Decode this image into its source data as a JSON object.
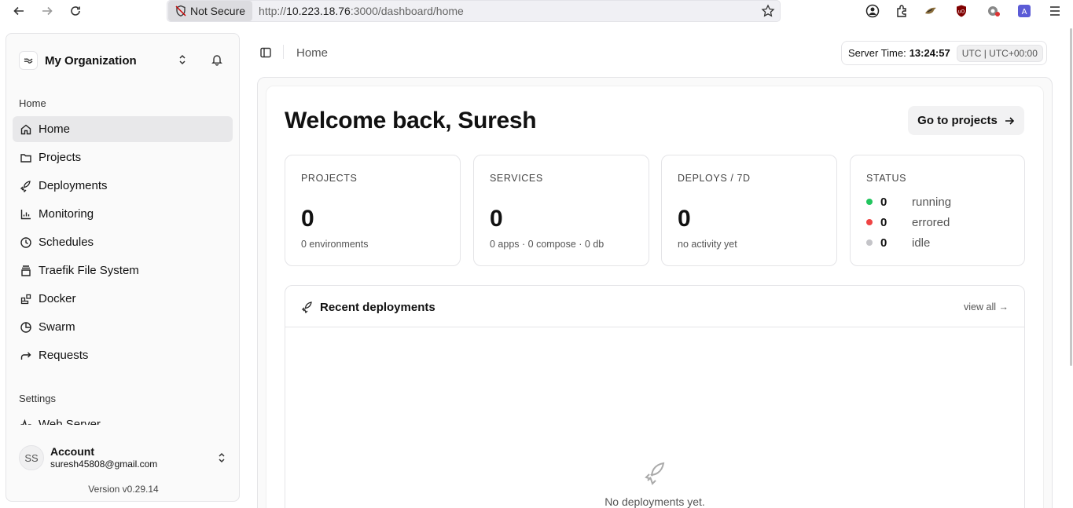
{
  "browser": {
    "not_secure": "Not Secure",
    "url_prefix": "http://",
    "url_host": "10.223.18.76",
    "url_rest": ":3000/dashboard/home"
  },
  "sidebar": {
    "org_name": "My Organization",
    "section_home": "Home",
    "section_settings": "Settings",
    "items": [
      {
        "label": "Home",
        "icon": "home-icon"
      },
      {
        "label": "Projects",
        "icon": "folder-icon"
      },
      {
        "label": "Deployments",
        "icon": "rocket-icon"
      },
      {
        "label": "Monitoring",
        "icon": "chart-icon"
      },
      {
        "label": "Schedules",
        "icon": "clock-icon"
      },
      {
        "label": "Traefik File System",
        "icon": "file-stack-icon"
      },
      {
        "label": "Docker",
        "icon": "blocks-icon"
      },
      {
        "label": "Swarm",
        "icon": "pie-icon"
      },
      {
        "label": "Requests",
        "icon": "forward-icon"
      }
    ],
    "settings_items": [
      {
        "label": "Web Server",
        "icon": "activity-icon"
      }
    ],
    "account": {
      "initials": "SS",
      "name": "Account",
      "email": "suresh45808@gmail.com"
    },
    "version": "Version v0.29.14"
  },
  "header": {
    "breadcrumb": "Home",
    "server_time_label": "Server Time:",
    "server_time": "13:24:57",
    "timezone": "UTC | UTC+00:00"
  },
  "main": {
    "welcome": "Welcome back, Suresh",
    "go_button": "Go to projects",
    "cards": [
      {
        "label": "PROJECTS",
        "value": "0",
        "sub": "0 environments"
      },
      {
        "label": "SERVICES",
        "value": "0",
        "sub": "0 apps · 0 compose · 0 db"
      },
      {
        "label": "DEPLOYS / 7D",
        "value": "0",
        "sub": "no activity yet"
      }
    ],
    "status": {
      "label": "STATUS",
      "rows": [
        {
          "value": "0",
          "label": "running",
          "color": "#22c55e"
        },
        {
          "value": "0",
          "label": "errored",
          "color": "#ef4444"
        },
        {
          "value": "0",
          "label": "idle",
          "color": "#c4c4c8"
        }
      ]
    },
    "recent": {
      "title": "Recent deployments",
      "view_all": "view all →",
      "empty": "No deployments yet."
    }
  }
}
